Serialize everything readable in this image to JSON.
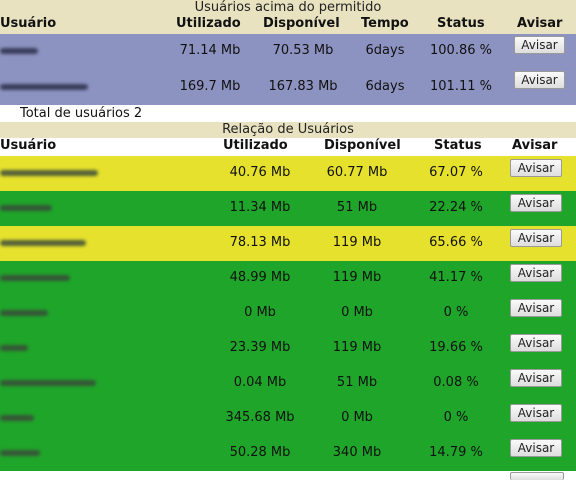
{
  "over_limit": {
    "title": "Usuários acima do permitido",
    "headers": {
      "user": "Usuário",
      "used": "Utilizado",
      "available": "Disponível",
      "time": "Tempo",
      "status": "Status",
      "notify": "Avisar"
    },
    "rows": [
      {
        "used": "71.14 Mb",
        "available": "70.53 Mb",
        "time": "6days",
        "status": "100.86 %",
        "button": "Avisar"
      },
      {
        "used": "169.7 Mb",
        "available": "167.83 Mb",
        "time": "6days",
        "status": "101.11 %",
        "button": "Avisar"
      }
    ],
    "total": "Total de usuários 2"
  },
  "users": {
    "title": "Relação de Usuários",
    "headers": {
      "user": "Usuário",
      "used": "Utilizado",
      "available": "Disponível",
      "status": "Status",
      "notify": "Avisar"
    },
    "rows": [
      {
        "used": "40.76 Mb",
        "available": "60.77 Mb",
        "status": "67.07 %",
        "button": "Avisar",
        "level": "warning"
      },
      {
        "used": "11.34 Mb",
        "available": "51 Mb",
        "status": "22.24 %",
        "button": "Avisar",
        "level": "ok"
      },
      {
        "used": "78.13 Mb",
        "available": "119 Mb",
        "status": "65.66 %",
        "button": "Avisar",
        "level": "warning"
      },
      {
        "used": "48.99 Mb",
        "available": "119 Mb",
        "status": "41.17 %",
        "button": "Avisar",
        "level": "ok"
      },
      {
        "used": "0 Mb",
        "available": "0 Mb",
        "status": "0 %",
        "button": "Avisar",
        "level": "ok"
      },
      {
        "used": "23.39 Mb",
        "available": "119 Mb",
        "status": "19.66 %",
        "button": "Avisar",
        "level": "ok"
      },
      {
        "used": "0.04 Mb",
        "available": "51 Mb",
        "status": "0.08 %",
        "button": "Avisar",
        "level": "ok"
      },
      {
        "used": "345.68 Mb",
        "available": "0 Mb",
        "status": "0 %",
        "button": "Avisar",
        "level": "ok"
      },
      {
        "used": "50.28 Mb",
        "available": "340 Mb",
        "status": "14.79 %",
        "button": "Avisar",
        "level": "ok"
      }
    ]
  },
  "colors": {
    "header_bg": "#e8e2c0",
    "over_limit_row": "#8d93c0",
    "warning_row": "#e6e12c",
    "ok_row": "#1fa52a",
    "blurred_name": "#3a4a3a"
  }
}
